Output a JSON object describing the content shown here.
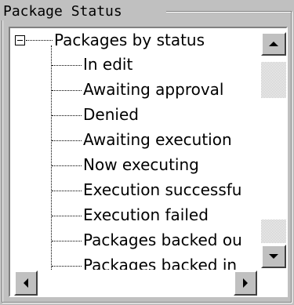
{
  "group": {
    "title": "Package Status"
  },
  "tree": {
    "root_label": "Packages by status",
    "children": [
      "In edit",
      "Awaiting approval",
      "Denied",
      "Awaiting execution",
      "Now executing",
      "Execution successfu",
      "Execution failed",
      "Packages backed ou",
      "Packages backed in"
    ]
  },
  "icons": {
    "expander": "minus-box-icon",
    "scroll_up": "arrow-up-icon",
    "scroll_down": "arrow-down-icon",
    "scroll_left": "arrow-left-icon",
    "scroll_right": "arrow-right-icon"
  },
  "colors": {
    "face": "#c0c0c0",
    "tree_bg": "#ffffff",
    "text": "#000000"
  }
}
